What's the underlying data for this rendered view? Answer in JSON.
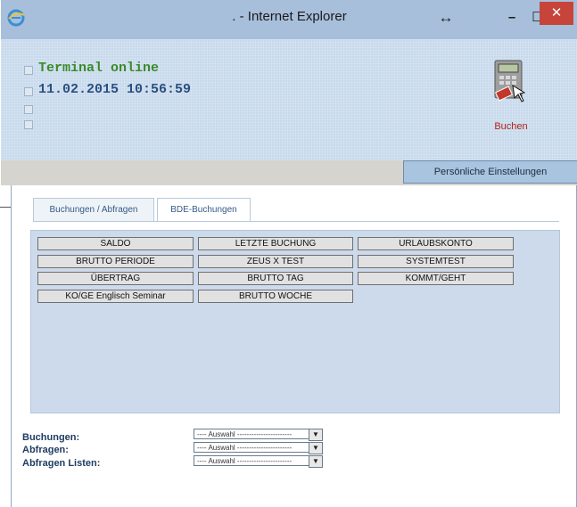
{
  "window": {
    "title": ". - Internet Explorer"
  },
  "header": {
    "status": "Terminal online",
    "datetime": "11.02.2015 10:56:59",
    "book_label": "Buchen"
  },
  "settings_button": "Persönliche Einstellungen",
  "tabs": [
    {
      "label": "Buchungen / Abfragen",
      "active": true
    },
    {
      "label": "BDE-Buchungen",
      "active": false
    }
  ],
  "buttons": [
    "SALDO",
    "LETZTE BUCHUNG",
    "URLAUBSKONTO",
    "BRUTTO PERIODE",
    "ZEUS X TEST",
    "SYSTEMTEST",
    "ÜBERTRAG",
    "BRUTTO TAG",
    "KOMMT/GEHT",
    "KO/GE Englisch Seminar",
    "BRUTTO WOCHE"
  ],
  "forms": [
    {
      "label": "Buchungen:",
      "selected": "---- Auswahl -----------------------"
    },
    {
      "label": "Abfragen:",
      "selected": "---- Auswahl -----------------------"
    },
    {
      "label": "Abfragen Listen:",
      "selected": "---- Auswahl -----------------------"
    }
  ],
  "colors": {
    "close_button": "#c7443b",
    "status_text": "#3a8a2a",
    "date_text": "#2a4f7f",
    "panel": "#ccdaec",
    "accent_label": "#1f3d63"
  }
}
